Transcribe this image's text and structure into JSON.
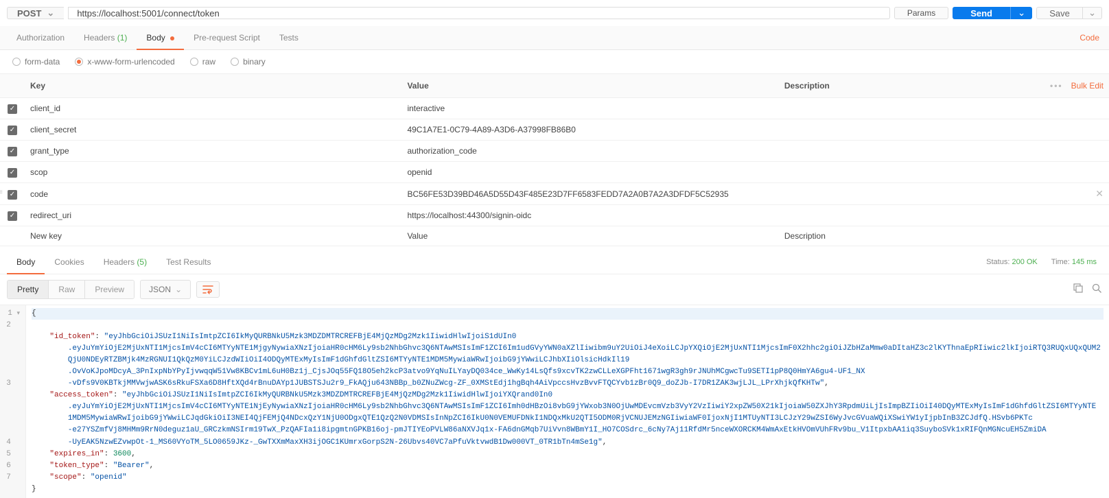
{
  "request": {
    "method": "POST",
    "url": "https://localhost:5001/connect/token",
    "params_btn": "Params",
    "send_btn": "Send",
    "save_btn": "Save"
  },
  "req_tabs": {
    "auth": "Authorization",
    "headers": "Headers",
    "headers_count": "(1)",
    "body": "Body",
    "prereq": "Pre-request Script",
    "tests": "Tests",
    "code_link": "Code"
  },
  "body_types": {
    "form": "form-data",
    "url": "x-www-form-urlencoded",
    "raw": "raw",
    "binary": "binary"
  },
  "params_header": {
    "key": "Key",
    "value": "Value",
    "description": "Description",
    "bulk": "Bulk Edit"
  },
  "params_rows": [
    {
      "key": "client_id",
      "value": "interactive"
    },
    {
      "key": "client_secret",
      "value": "49C1A7E1-0C79-4A89-A3D6-A37998FB86B0"
    },
    {
      "key": "grant_type",
      "value": "authorization_code"
    },
    {
      "key": "scop",
      "value": "openid"
    },
    {
      "key": "code",
      "value": "BC56FE53D39BD46A5D55D43F485E23D7FF6583FEDD7A2A0B7A2A3DFDF5C52935"
    },
    {
      "key": "redirect_uri",
      "value": "https://localhost:44300/signin-oidc"
    }
  ],
  "params_placeholder": {
    "key": "New key",
    "value": "Value",
    "desc": "Description"
  },
  "resp_tabs": {
    "body": "Body",
    "cookies": "Cookies",
    "headers": "Headers",
    "headers_count": "(5)",
    "tests": "Test Results"
  },
  "resp_meta": {
    "status_label": "Status:",
    "status_val": "200 OK",
    "time_label": "Time:",
    "time_val": "145 ms"
  },
  "resp_toolbar": {
    "pretty": "Pretty",
    "raw": "Raw",
    "preview": "Preview",
    "lang": "JSON"
  },
  "json_body": {
    "id_token_key": "\"id_token\"",
    "id_token_val_l1": "\"eyJhbGciOiJSUzI1NiIsImtpZCI6IkMyQURBNkU5Mzk3MDZDMTRCREFBjE4MjQzMDg2Mzk1IiwidHlwIjoiS1dUIn0",
    "id_token_val_l2": ".eyJuYmYiOjE2MjUxNTI1MjcsImV4cCI6MTYyNTE1MjgyNywiaXNzIjoiaHR0cHM6Ly9sb2NhbGhvc3Q6NTAwMSIsImF1ZCI6Im1udGVyYWN0aXZlIiwibm9uY2UiOiJ4eXoiLCJpYXQiOjE2MjUxNTI1MjcsImF0X2hhc2giOiJZbHZaMmw0aDItaHZ3c2lKYThnaEpRIiwic2lkIjoiRTQ3RUQxUQxQUM2",
    "id_token_val_l3": "QjU0NDEyRTZBMjk4MzRGNUI1QkQzM0YiLCJzdWIiOiI4ODQyMTExMyIsImF1dGhfdGltZSI6MTYyNTE1MDM5MywiaWRwIjoibG9jYWwiLCJhbXIiOlsicHdkIl19",
    "id_token_val_l4": ".OvVoKJpoMDcyA_3PnIxpNbYPyIjvwqqW51Vw8KBCv1mL6uH0Bz1j_CjsJOq55FQ18O5eh2kcP3atvo9YqNuILYayDQ034ce_WwKy14LsQfs9xcvTK2zwCLLeXGPFht1671wgR3gh9rJNUhMCgwcTu9SETI1pP8Q0HmYA6gu4-UF1_NX",
    "id_token_val_l5": "-vDfs9V0KBTkjMMVwjwASK6sRkuFSXa6D8HftXQd4rBnuDAYp1JUBSTSJu2r9_FkAQju643NBBp_b0ZNuZWcg-ZF_0XMStEdj1hgBqh4AiVpccsHvzBvvFTQCYvb1zBr0Q9_doZJb-I7DR1ZAK3wjLJL_LPrXhjkQfKHTw\"",
    "access_token_key": "\"access_token\"",
    "access_token_val_l1": "\"eyJhbGciOiJSUzI1NiIsImtpZCI6IkMyQURBNkU5Mzk3MDZDMTRCREFBjE4MjQzMDg2Mzk1IiwidHlwIjoiYXQrand0In0",
    "access_token_val_l2": ".eyJuYmYiOjE2MjUxNTI1MjcsImV4cCI6MTYyNTE1NjEyNywiaXNzIjoiaHR0cHM6Ly9sb2NhbGhvc3Q6NTAwMSIsImF1ZCI6Imh0dHBzOi8vbG9jYWxob3N0OjUwMDEvcmVzb3VyY2VzIiwiY2xpZW50X21kIjoiaW50ZXJhY3RpdmUiLjIsImpBZIiOiI40DQyMTExMyIsImF1dGhfdGltZSI6MTYyNTE",
    "access_token_val_l3": "1MDM5MywiaWRwIjoibG9jYWwiLCJqdGkiOiI3NEI4QjFEMjQ4NDcxQzY1NjU0ODgxQTE1QzQ2N0VDMSIsInNpZCI6IkU0N0VEMUFDNkI1NDQxMkU2QTI5ODM0RjVCNUJEMzNGIiwiaWF0IjoxNjI1MTUyNTI3LCJzY29wZSI6WyJvcGVuaWQiXSwiYW1yIjpbInB3ZCJdfQ.HSvb6PKTc",
    "access_token_val_l4": "-e27YSZmfVj8MHMm9RrN0deguz1aU_GRCzkmNSIrm19TwX_PzQAFIa1i8ipgmtnGPKB16oj-pmJTIYEoPVLW86aNXVJq1x-FA6dnGMqb7UiVvn8WBmY1I_HO7COSdrc_6cNy7Aj11RfdMr5nceWXORCKM4WmAxEtkHVOmVUhFRv9bu_V1ItpxbAA1iq3SuyboSVk1xRIFQnMGNcuEH5ZmiDA",
    "access_token_val_l5": "-UyEAK5NzwEZvwpOt-1_MS60VYoTM_5LO0659JKz-_GwTXXmMaxXH3ijOGC1KUmrxGorpS2N-26Ubvs40VC7aPfuVktvwdB1Dw000VT_0TR1bTn4mSe1g\"",
    "expires_in_key": "\"expires_in\"",
    "expires_in_val": "3600",
    "token_type_key": "\"token_type\"",
    "token_type_val": "\"Bearer\"",
    "scope_key": "\"scope\"",
    "scope_val": "\"openid\""
  }
}
